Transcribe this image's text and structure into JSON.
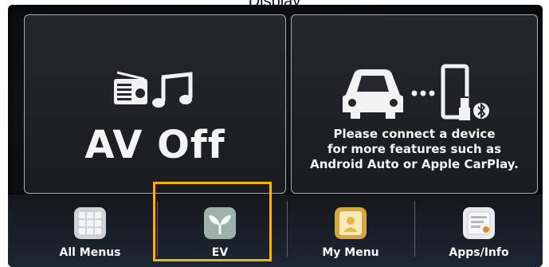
{
  "page_caption": "Display",
  "av_panel": {
    "status_text": "AV Off",
    "icons": [
      "radio-icon",
      "music-note-icon"
    ]
  },
  "device_panel": {
    "icons": [
      "car-icon",
      "ellipsis-icon",
      "phone-icon",
      "usb-icon",
      "bluetooth-icon"
    ],
    "message_lines": [
      "Please connect a device",
      "for more features such as",
      "Android Auto or Apple CarPlay."
    ]
  },
  "apps": [
    {
      "label": "All Menus",
      "icon": "grid-icon"
    },
    {
      "label": "EV",
      "icon": "leaf-icon"
    },
    {
      "label": "My Menu",
      "icon": "my-menu-icon"
    },
    {
      "label": "Apps/Info",
      "icon": "apps-info-icon"
    }
  ],
  "highlight_color": "#f3b21b"
}
